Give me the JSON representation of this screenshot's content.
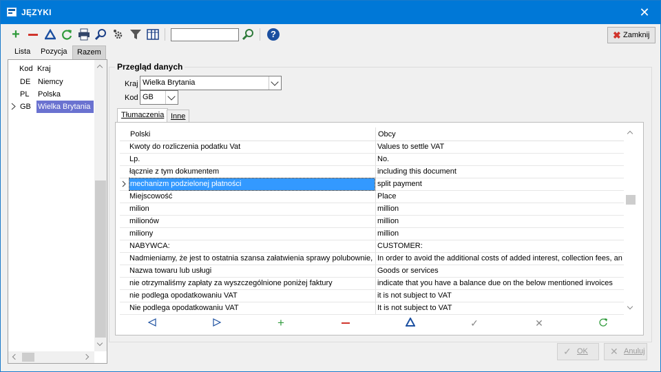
{
  "window": {
    "title": "JĘZYKI",
    "close_glyph": "✕"
  },
  "toolbar": {
    "close_label": "Zamknij",
    "search_value": "",
    "icons": [
      "add-icon",
      "delete-icon",
      "edit-icon",
      "refresh-icon",
      "print-icon",
      "search-icon",
      "settings-icon",
      "filter-icon",
      "columns-icon",
      "find-icon",
      "help-icon"
    ]
  },
  "top_tabs": [
    "Lista",
    "Pozycja",
    "Razem"
  ],
  "left_list": {
    "headers": {
      "kod": "Kod",
      "kraj": "Kraj"
    },
    "rows": [
      {
        "kod": "DE",
        "kraj": "Niemcy"
      },
      {
        "kod": "PL",
        "kraj": "Polska"
      },
      {
        "kod": "GB",
        "kraj": "Wielka Brytania"
      }
    ]
  },
  "overview": {
    "title": "Przegląd danych",
    "kraj_label": "Kraj",
    "kraj_value": "Wielka Brytania",
    "kod_label": "Kod",
    "kod_value": "GB"
  },
  "inner_tabs": [
    "Tłumaczenia",
    "Inne"
  ],
  "grid": {
    "headers": {
      "polski": "Polski",
      "obcy": "Obcy"
    },
    "rows": [
      {
        "polski": "Kwoty do rozliczenia podatku Vat",
        "obcy": "Values to settle VAT"
      },
      {
        "polski": "Lp.",
        "obcy": "No."
      },
      {
        "polski": "łącznie z tym dokumentem",
        "obcy": "including this document"
      },
      {
        "polski": "mechanizm podzielonej płatności",
        "obcy": "split payment"
      },
      {
        "polski": "Miejscowość",
        "obcy": "Place"
      },
      {
        "polski": "milion",
        "obcy": "million"
      },
      {
        "polski": "milionów",
        "obcy": "million"
      },
      {
        "polski": "miliony",
        "obcy": "million"
      },
      {
        "polski": "NABYWCA:",
        "obcy": "CUSTOMER:"
      },
      {
        "polski": "Nadmieniamy, że jest to ostatnia szansa załatwienia sprawy polubownie, b",
        "obcy": "In order to avoid the additional costs of added interest, collection fees, an"
      },
      {
        "polski": "Nazwa towaru lub usługi",
        "obcy": "Goods or services"
      },
      {
        "polski": "nie otrzymaliśmy zapłaty za wyszczególnione poniżej faktury",
        "obcy": "indicate that you have a balance due on the below mentioned invoices"
      },
      {
        "polski": "nie podlega opodatkowaniu VAT",
        "obcy": "it is not subject to VAT"
      },
      {
        "polski": "Nie podlega opodatkowaniu VAT",
        "obcy": "It is not subject to VAT"
      }
    ]
  },
  "buttons": {
    "ok": "OK",
    "cancel": "Anuluj"
  },
  "colors": {
    "titlebar": "#0078d7",
    "selection": "#3399ff",
    "list_selection": "#6a72d0",
    "add": "#2e9a3a",
    "delete": "#d0342c"
  }
}
